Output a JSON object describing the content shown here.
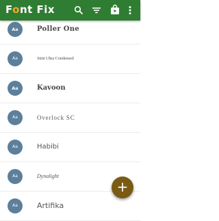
{
  "appbar": {
    "title_prefix": "F",
    "title_o": "o",
    "title_suffix": "nt Fix",
    "icons": [
      "search-icon",
      "filter-icon",
      "store-icon",
      "more-vert-icon"
    ],
    "color": "#2e7d32",
    "accent": "#f9a825"
  },
  "fonts": [
    {
      "avatar": "Aa",
      "name": "Poller One"
    },
    {
      "avatar": "Aa",
      "name": "Stint Ultra Condensed"
    },
    {
      "avatar": "Aa",
      "name": "Kavoon"
    },
    {
      "avatar": "Aa",
      "name": "Overlock SC"
    },
    {
      "avatar": "Aa",
      "name": "Habibi"
    },
    {
      "avatar": "Aa",
      "name": "Dynalight"
    },
    {
      "avatar": "Aa",
      "name": "Artifika"
    }
  ],
  "fab": {
    "label": "+",
    "icon": "add-icon",
    "color": "#7a5a14"
  }
}
